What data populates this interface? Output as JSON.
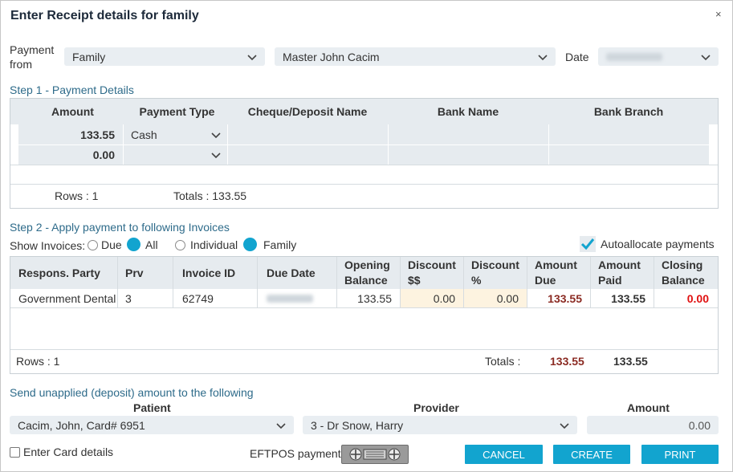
{
  "dialog": {
    "title": "Enter Receipt details for family",
    "close": "×"
  },
  "header": {
    "payment_from_label": "Payment\nfrom",
    "payment_from_value": "Family",
    "person_value": "Master John  Cacim",
    "date_label": "Date"
  },
  "step1": {
    "title": "Step 1 - Payment Details",
    "columns": [
      "Amount",
      "Payment Type",
      "Cheque/Deposit Name",
      "Bank Name",
      "Bank Branch"
    ],
    "rows": [
      {
        "amount": "133.55",
        "type": "Cash"
      },
      {
        "amount": "0.00",
        "type": ""
      }
    ],
    "rows_label": "Rows : 1",
    "totals_label": "Totals : 133.55"
  },
  "step2": {
    "title": "Step 2 - Apply payment to following Invoices",
    "show_label": "Show Invoices:",
    "radio_due": "Due",
    "radio_all": "All",
    "radio_individual": "Individual",
    "radio_family": "Family",
    "autoallocate": "Autoallocate payments",
    "columns": [
      "Respons. Party",
      "Prv",
      "Invoice ID",
      "Due Date",
      "Opening\nBalance",
      "Discount\n$$",
      "Discount\n%",
      "Amount\nDue",
      "Amount\nPaid",
      "Closing\nBalance"
    ],
    "rows": [
      {
        "party": "Government Dental",
        "prv": "3",
        "invoice": "62749",
        "opening": "133.55",
        "disc_amt": "0.00",
        "disc_pct": "0.00",
        "due": "133.55",
        "paid": "133.55",
        "closing": "0.00"
      }
    ],
    "rows_label": "Rows : 1",
    "totals_label": "Totals :",
    "total_due": "133.55",
    "total_paid": "133.55"
  },
  "unapplied": {
    "title": "Send unapplied (deposit) amount to the following",
    "patient_label": "Patient",
    "provider_label": "Provider",
    "amount_label": "Amount",
    "patient_value": "Cacim, John, Card# 6951",
    "provider_value": "3 - Dr Snow, Harry",
    "amount_value": "0.00"
  },
  "footer": {
    "card_details": "Enter Card details",
    "eftpos_label": "EFTPOS payment",
    "cancel": "CANCEL",
    "create": "CREATE",
    "print": "PRINT"
  },
  "icons": [
    "close-icon",
    "chevron-down-icon",
    "checkmark-icon",
    "eftpos-terminal-icon"
  ],
  "colors": {
    "accent": "#12a4cf",
    "amount_due": "#8b2b23",
    "closing_balance": "#e01010",
    "section_title": "#2e6b8a"
  }
}
